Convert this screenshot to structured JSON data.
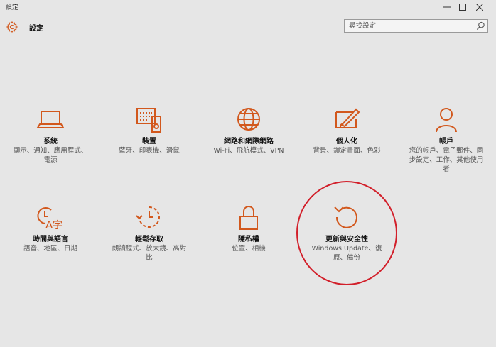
{
  "window": {
    "title": "設定",
    "controls": [
      "minimize",
      "maximize",
      "close"
    ]
  },
  "header": {
    "app_title": "設定",
    "search_placeholder": "尋找設定"
  },
  "colors": {
    "accent": "#d2581d",
    "background": "#e6e6e6",
    "annotation": "#d21f2a"
  },
  "tiles": [
    {
      "name": "系統",
      "desc": "顯示、通知、應用程式、電源",
      "icon": "laptop-icon"
    },
    {
      "name": "裝置",
      "desc": "藍牙、印表機、滑鼠",
      "icon": "devices-icon"
    },
    {
      "name": "網路和網際網路",
      "desc": "Wi-Fi、飛航模式、VPN",
      "icon": "globe-icon"
    },
    {
      "name": "個人化",
      "desc": "背景、鎖定畫面、色彩",
      "icon": "personalization-icon"
    },
    {
      "name": "帳戶",
      "desc": "您的帳戶、電子郵件、同步設定、工作、其他使用者",
      "icon": "person-icon"
    },
    {
      "name": "時間與語言",
      "desc": "語音、地區、日期",
      "icon": "time-language-icon"
    },
    {
      "name": "輕鬆存取",
      "desc": "朗讀程式、放大鏡、高對比",
      "icon": "ease-of-access-icon"
    },
    {
      "name": "隱私權",
      "desc": "位置、相機",
      "icon": "lock-icon"
    },
    {
      "name": "更新與安全性",
      "desc": "Windows Update、復原、備份",
      "icon": "update-icon"
    }
  ]
}
